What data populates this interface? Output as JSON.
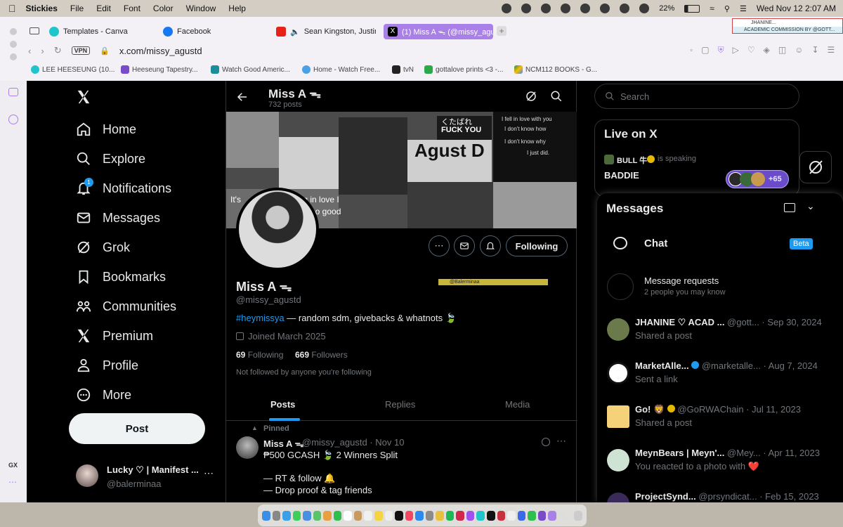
{
  "menubar": {
    "app": "Stickies",
    "items": [
      "File",
      "Edit",
      "Font",
      "Color",
      "Window",
      "Help"
    ],
    "battery": "22%",
    "datetime": "Wed Nov 12  2:07 AM"
  },
  "browser": {
    "tabs": [
      {
        "label": "Templates - Canva"
      },
      {
        "label": "Facebook"
      },
      {
        "label": "Sean Kingston, Justin"
      },
      {
        "label": "(1) Miss A ᯓ (@missy_agu"
      }
    ],
    "url": "x.com/missy_agustd",
    "vpn": "VPN",
    "bookmarks": [
      "LEE HEESEUNG (10...",
      "Heeseung Tapestry...",
      "Watch Good Americ...",
      "Home - Watch Free...",
      "tvN",
      "gottalove prints <3 -...",
      "NCM112 BOOKS - G..."
    ],
    "pinned_popup": {
      "title": "JHANINE...",
      "caption": "ACADEMIC COMMISSION BY @GOTT..."
    }
  },
  "sidebar_strip": {
    "gx": "GX"
  },
  "nav": {
    "items": [
      "Home",
      "Explore",
      "Notifications",
      "Messages",
      "Grok",
      "Bookmarks",
      "Communities",
      "Premium",
      "Profile",
      "More"
    ],
    "notif_badge": "1",
    "post_label": "Post",
    "account": {
      "name": "Lucky ♡ | Manifest ...",
      "handle": "@balerminaa"
    }
  },
  "profile": {
    "header_name": "Miss A ᯓ",
    "posts_count": "732 posts",
    "banner_texts": [
      "Agust D",
      "くたばれ",
      "FUCK YOU",
      "I fell in love with you",
      "I don't know how",
      "I don't know why",
      "I just did.",
      "It's",
      "ing in love I",
      "me no good"
    ],
    "name": "Miss A ᯓ",
    "handle": "@missy_agustd",
    "bio_tag": "#heymissya",
    "bio_rest": " — random sdm, givebacks & whatnots 🍃",
    "joined": "Joined March 2025",
    "following_count": "69",
    "following_label": "Following",
    "followers_count": "669",
    "followers_label": "Followers",
    "not_followed": "Not followed by anyone you're following",
    "following_button": "Following",
    "watermark": "@Balerminaa"
  },
  "tabs": [
    "Posts",
    "Replies",
    "Media"
  ],
  "pinned_post": {
    "pinned_label": "Pinned",
    "author": "Miss A ᯓ",
    "handle_date": "@missy_agustd · Nov 10",
    "line1": "₱500 GCASH 🍃 2 Winners Split",
    "line2": "— RT & follow 🔔",
    "line3": "— Drop proof & tag friends"
  },
  "search": {
    "placeholder": "Search"
  },
  "live": {
    "title": "Live on X",
    "host": "BULL 牛",
    "speaking": "is speaking",
    "space": "BADDIE",
    "listeners": "+65"
  },
  "messages": {
    "title": "Messages",
    "chat": "Chat",
    "beta": "Beta",
    "requests_title": "Message requests",
    "requests_sub": "2 people you may know",
    "conversations": [
      {
        "name": "JHANINE ♡ ACAD ...",
        "meta": "@gott... · Sep 30, 2024",
        "preview": "Shared a post",
        "color": "#6b7a4a"
      },
      {
        "name": "MarketAlle...",
        "meta": "@marketalle... · Aug 7, 2024",
        "preview": "Sent a link",
        "color": "#ffffff"
      },
      {
        "name": "Go! 🦁",
        "meta": "@GoRWAChain · Jul 11, 2023",
        "preview": "Shared a post",
        "color": "#f5d27a"
      },
      {
        "name": "MeynBears | Meyn'...",
        "meta": "@Mey... · Apr 11, 2023",
        "preview": "You reacted to a photo with ❤️",
        "color": "#cfe3d4"
      },
      {
        "name": "ProjectSynd...",
        "meta": "@prsyndicat... · Feb 15, 2023",
        "preview": "",
        "color": "#3a2a5a"
      }
    ]
  },
  "colors": {
    "accent": "#1d9bf0",
    "tab_active": "#a980e8",
    "gold": "#c9b53a"
  }
}
